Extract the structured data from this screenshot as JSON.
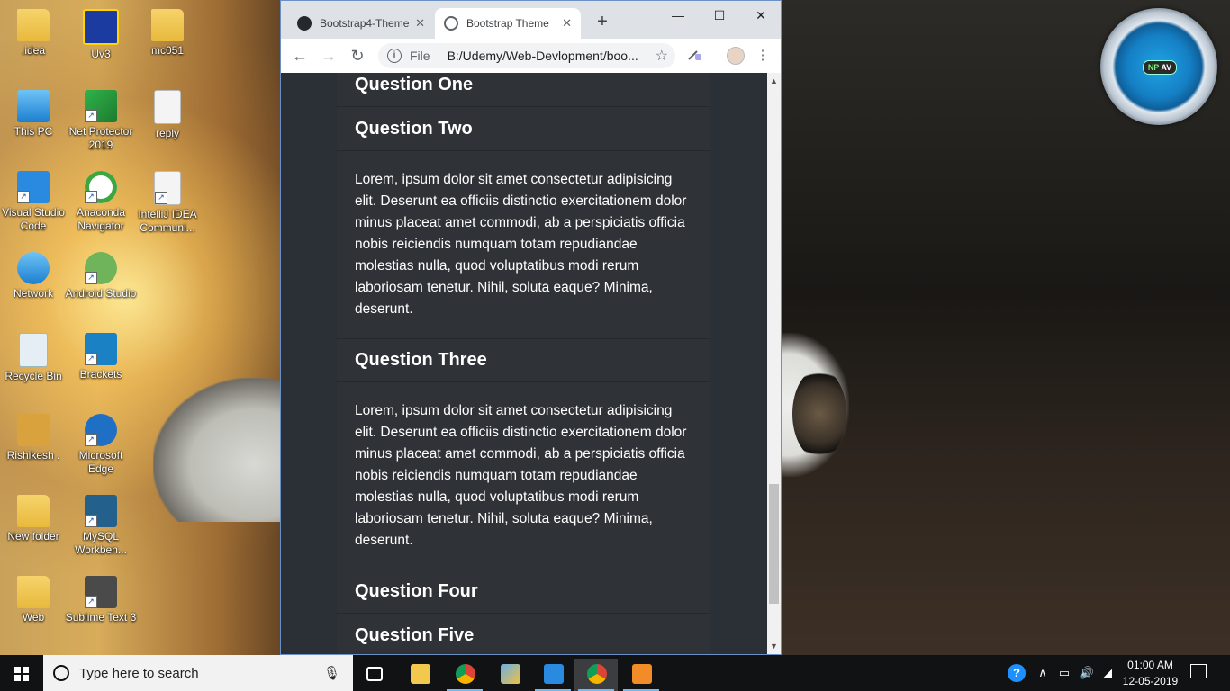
{
  "desktop": {
    "icons": [
      {
        "label": ".idea"
      },
      {
        "label": "This PC"
      },
      {
        "label": "Visual Studio Code"
      },
      {
        "label": "Network"
      },
      {
        "label": "Recycle Bin"
      },
      {
        "label": "Rishikesh ."
      },
      {
        "label": "New folder"
      },
      {
        "label": "Web"
      },
      {
        "label": "Uv3"
      },
      {
        "label": "Net Protector 2019"
      },
      {
        "label": "Anaconda Navigator"
      },
      {
        "label": "Android Studio"
      },
      {
        "label": "Brackets"
      },
      {
        "label": "Microsoft Edge"
      },
      {
        "label": "MySQL Workben..."
      },
      {
        "label": "Sublime Text 3"
      },
      {
        "label": "mc051"
      },
      {
        "label": "reply"
      },
      {
        "label": "IntelliJ IDEA Communi..."
      }
    ],
    "npav_badge": {
      "np": "NP",
      "av": "AV"
    }
  },
  "browser": {
    "tabs": [
      {
        "title": "Bootstrap4-Theme",
        "icon": "github-icon",
        "active": false
      },
      {
        "title": "Bootstrap Theme",
        "icon": "globe-icon",
        "active": true
      }
    ],
    "new_tab": "+",
    "controls": {
      "minimize": "—",
      "maximize": "☐",
      "close": "✕"
    },
    "toolbar": {
      "back": "←",
      "forward": "→",
      "reload": "↻",
      "scheme": "File",
      "url": "B:/Udemy/Web-Devlopment/boo...",
      "star": "☆",
      "menu": "⋮",
      "info": "i"
    }
  },
  "page": {
    "accordion": [
      {
        "question": "Question One"
      },
      {
        "question": "Question Two",
        "answer": "Lorem, ipsum dolor sit amet consectetur adipisicing elit. Deserunt ea officiis distinctio exercitationem dolor minus placeat amet commodi, ab a perspiciatis officia nobis reiciendis numquam totam repudiandae molestias nulla, quod voluptatibus modi rerum laboriosam tenetur. Nihil, soluta eaque? Minima, deserunt."
      },
      {
        "question": "Question Three",
        "answer": "Lorem, ipsum dolor sit amet consectetur adipisicing elit. Deserunt ea officiis distinctio exercitationem dolor minus placeat amet commodi, ab a perspiciatis officia nobis reiciendis numquam totam repudiandae molestias nulla, quod voluptatibus modi rerum laboriosam tenetur. Nihil, soluta eaque? Minima, deserunt."
      },
      {
        "question": "Question Four"
      },
      {
        "question": "Question Five"
      }
    ],
    "scroll_position_fraction": 0.85
  },
  "taskbar": {
    "search_placeholder": "Type here to search",
    "time": "01:00 AM",
    "date": "12-05-2019",
    "help": "?",
    "chevron": "∧"
  },
  "colors": {
    "page_bg": "#2b2f36",
    "panel_bg": "#2f3237",
    "taskbar_bg": "#111213",
    "accent": "#76b9ed"
  }
}
